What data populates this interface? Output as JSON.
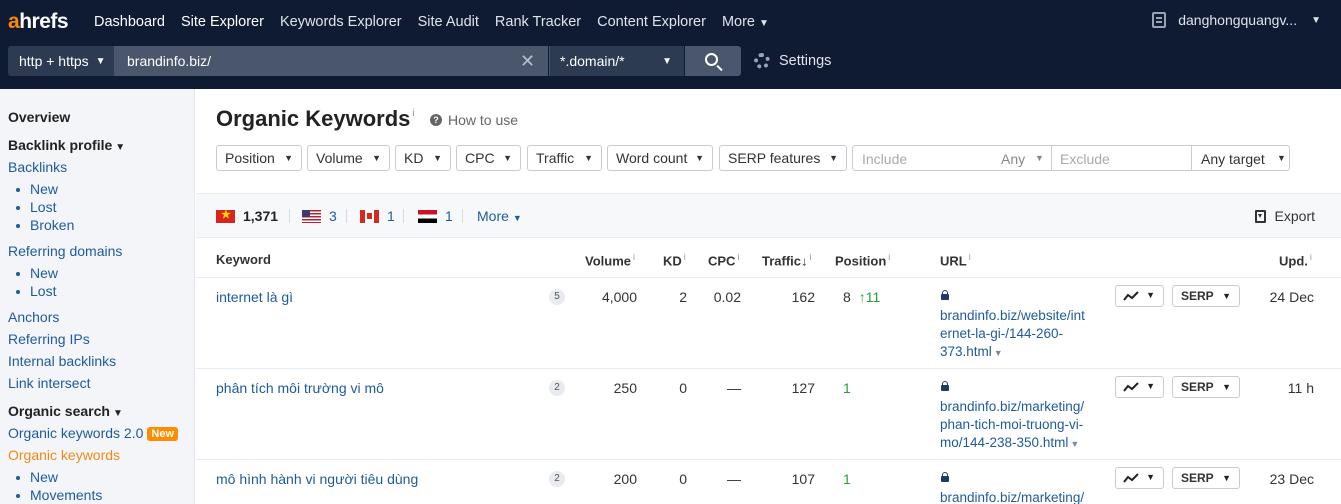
{
  "nav": {
    "logo_a": "a",
    "logo_rest": "hrefs",
    "items": [
      "Dashboard",
      "Site Explorer",
      "Keywords Explorer",
      "Site Audit",
      "Rank Tracker",
      "Content Explorer",
      "More"
    ],
    "user": "danghongquangv..."
  },
  "search": {
    "protocol": "http + https",
    "target": "brandinfo.biz/",
    "mode": "*.domain/*",
    "settings_label": "Settings"
  },
  "sidebar": {
    "overview": "Overview",
    "backlink_profile": "Backlink profile",
    "backlinks": "Backlinks",
    "backlinks_sub": [
      "New",
      "Lost",
      "Broken"
    ],
    "referring_domains": "Referring domains",
    "referring_domains_sub": [
      "New",
      "Lost"
    ],
    "anchors": "Anchors",
    "referring_ips": "Referring IPs",
    "internal_backlinks": "Internal backlinks",
    "link_intersect": "Link intersect",
    "organic_search": "Organic search",
    "organic_keywords_2": "Organic keywords 2.0",
    "new_badge": "New",
    "organic_keywords": "Organic keywords",
    "organic_sub": [
      "New",
      "Movements"
    ]
  },
  "main": {
    "title": "Organic Keywords",
    "info": "i",
    "how_to_use": "How to use",
    "filters": [
      "Position",
      "Volume",
      "KD",
      "CPC",
      "Traffic",
      "Word count",
      "SERP features"
    ],
    "include_placeholder": "Include",
    "any": "Any",
    "exclude_placeholder": "Exclude",
    "any_target": "Any target"
  },
  "countries": {
    "vn": "1,371",
    "us": "3",
    "ca": "1",
    "eg": "1",
    "more": "More",
    "export": "Export"
  },
  "table": {
    "headers": {
      "keyword": "Keyword",
      "volume": "Volume",
      "kd": "KD",
      "cpc": "CPC",
      "traffic": "Traffic",
      "traffic_sort": "↓",
      "position": "Position",
      "url": "URL",
      "upd": "Upd."
    },
    "serp_button": "SERP",
    "rows": [
      {
        "keyword": "internet là gì",
        "serp_count": "5",
        "volume": "4,000",
        "kd": "2",
        "cpc": "0.02",
        "traffic": "162",
        "position": "8",
        "change": "↑11",
        "url_lines": [
          "brandinfo.biz/website/int",
          "ernet-la-gi-/144-260-",
          "373.html"
        ],
        "upd": "24 Dec"
      },
      {
        "keyword": "phân tích môi trường vi mô",
        "serp_count": "2",
        "volume": "250",
        "kd": "0",
        "cpc": "—",
        "traffic": "127",
        "position": "1",
        "change": "",
        "url_lines": [
          "brandinfo.biz/marketing/",
          "phan-tich-moi-truong-vi-",
          "mo/144-238-350.html"
        ],
        "upd": "11 h"
      },
      {
        "keyword": "mô hình hành vi người tiêu dùng",
        "serp_count": "2",
        "volume": "200",
        "kd": "0",
        "cpc": "—",
        "traffic": "107",
        "position": "1",
        "change": "",
        "url_lines": [
          "brandinfo.biz/marketing/"
        ],
        "upd": "23 Dec"
      }
    ]
  },
  "colors": {
    "nav_bg": "#0f1b33",
    "accent": "#ff8800",
    "link": "#1f5a9e",
    "positive": "#2a9d3d"
  }
}
